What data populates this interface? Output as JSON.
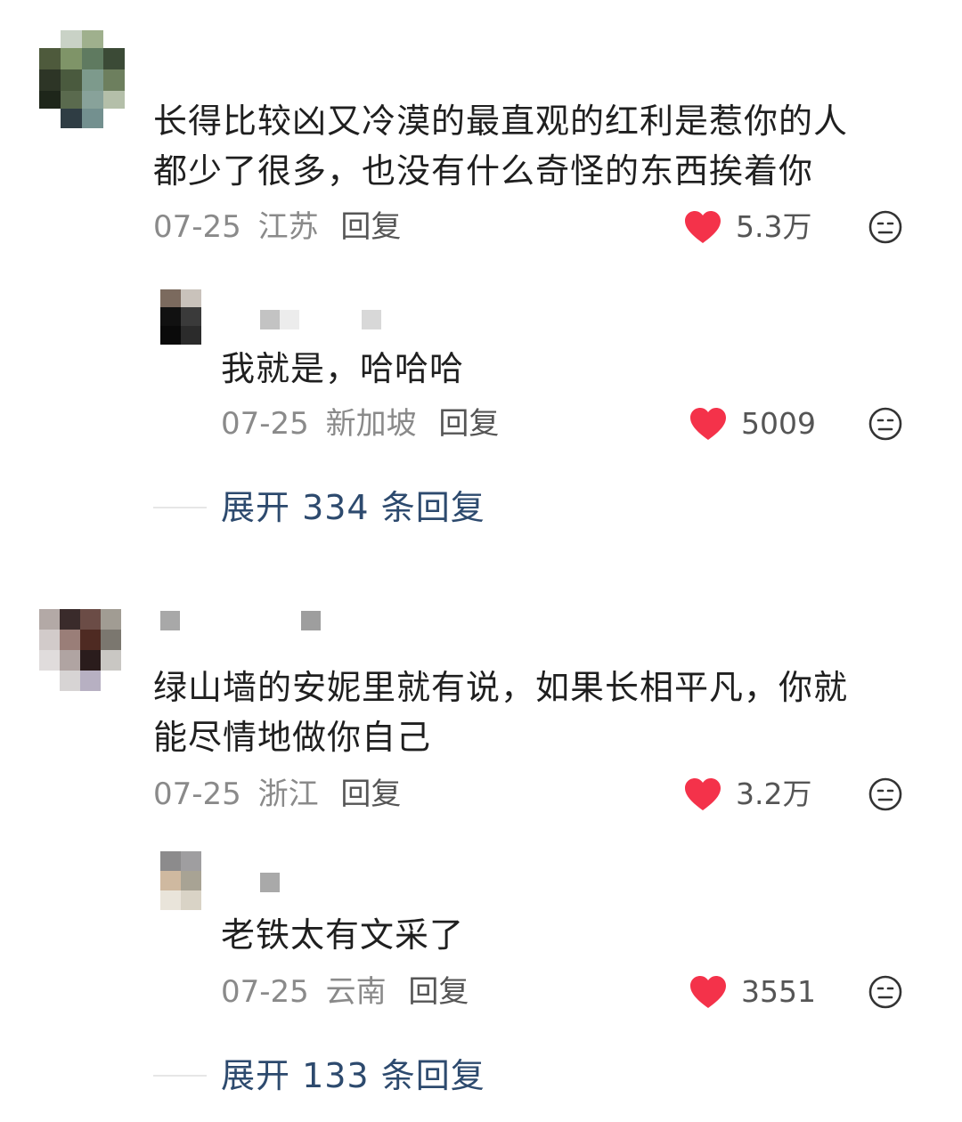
{
  "comments": [
    {
      "text_line1": "长得比较凶又冷漠的最直观的红利是惹你的人",
      "text_line2": "都少了很多，也没有什么奇怪的东西挨着你",
      "date": "07-25",
      "location": "江苏",
      "reply_label": "回复",
      "likes": "5.3万",
      "reply": {
        "text": "我就是，哈哈哈",
        "date": "07-25",
        "location": "新加坡",
        "reply_label": "回复",
        "likes": "5009"
      },
      "expand_label": "展开 334 条回复"
    },
    {
      "text_line1": "绿山墙的安妮里就有说，如果长相平凡，你就",
      "text_line2": "能尽情地做你自己",
      "date": "07-25",
      "location": "浙江",
      "reply_label": "回复",
      "likes": "3.2万",
      "reply": {
        "text": "老铁太有文采了",
        "date": "07-25",
        "location": "云南",
        "reply_label": "回复",
        "likes": "3551"
      },
      "expand_label": "展开 133 条回复"
    }
  ],
  "colors": {
    "like_heart": "#f4324a",
    "expand_link": "#2d4a6e",
    "meta_text": "#8a8a8a"
  },
  "icons": {
    "like": "heart-icon",
    "dislike": "unhappy-face-icon"
  }
}
